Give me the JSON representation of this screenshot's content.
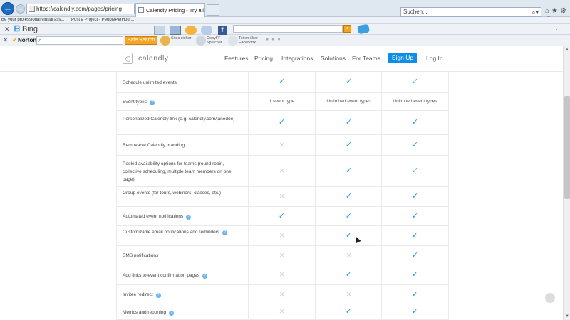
{
  "browser": {
    "url": "https://calendly.com/pages/pricing",
    "tabs": [
      {
        "label": "Calendly Pricing - Try all fe..."
      }
    ],
    "search_placeholder": "Suchen...",
    "favorites": [
      {
        "label": "Be your professional virtual ass..."
      },
      {
        "label": "Post a Project - PeoplePerHour..."
      }
    ]
  },
  "bing_bar": {
    "logo": "Bing"
  },
  "norton_bar": {
    "name": "Norton",
    "safe_search": "Safe Search",
    "items": [
      {
        "label": "Sites sicher"
      },
      {
        "label": "CopyFF Speicher"
      },
      {
        "label": "Teilen über Facebook"
      }
    ]
  },
  "site": {
    "logo": "calendly",
    "nav": [
      "Features",
      "Pricing",
      "Integrations",
      "Solutions",
      "For Teams"
    ],
    "signup": "Sign Up",
    "login": "Log In"
  },
  "features": [
    {
      "label": "Schedule unlimited events",
      "help": false,
      "values": [
        "check",
        "check",
        "check"
      ]
    },
    {
      "label": "Event types",
      "help": true,
      "values": [
        "1 event type",
        "Unlimited event types",
        "Unlimited event types"
      ]
    },
    {
      "label": "Personalized Calendly link (e.g. calendly.com/janedoe)",
      "help": false,
      "values": [
        "check",
        "check",
        "check"
      ]
    },
    {
      "label": "Removable Calendly branding",
      "help": false,
      "values": [
        "cross",
        "check",
        "check"
      ]
    },
    {
      "label": "Pooled availability options for teams (round robin, collective scheduling, multiple team members on one page)",
      "help": false,
      "values": [
        "cross",
        "check",
        "check"
      ]
    },
    {
      "label": "Group events (for tours, webinars, classes, etc.)",
      "help": false,
      "values": [
        "cross",
        "check",
        "check"
      ]
    },
    {
      "label": "Automated event notifications",
      "help": true,
      "values": [
        "check",
        "check",
        "check"
      ]
    },
    {
      "label": "Customizable email notifications and reminders",
      "help": true,
      "values": [
        "cross",
        "check",
        "check"
      ]
    },
    {
      "label": "SMS notifications",
      "help": false,
      "values": [
        "cross",
        "cross",
        "check"
      ]
    },
    {
      "label": "Add links to event confirmation pages",
      "help": true,
      "values": [
        "cross",
        "check",
        "check"
      ]
    },
    {
      "label": "Invitee redirect",
      "help": true,
      "values": [
        "cross",
        "cross",
        "check"
      ]
    },
    {
      "label": "Metrics and reporting",
      "help": true,
      "values": [
        "cross",
        "check",
        "check"
      ]
    }
  ],
  "colors": {
    "accent": "#0f8ee8",
    "check": "#1d9be6",
    "cross": "#c8cdd2"
  }
}
